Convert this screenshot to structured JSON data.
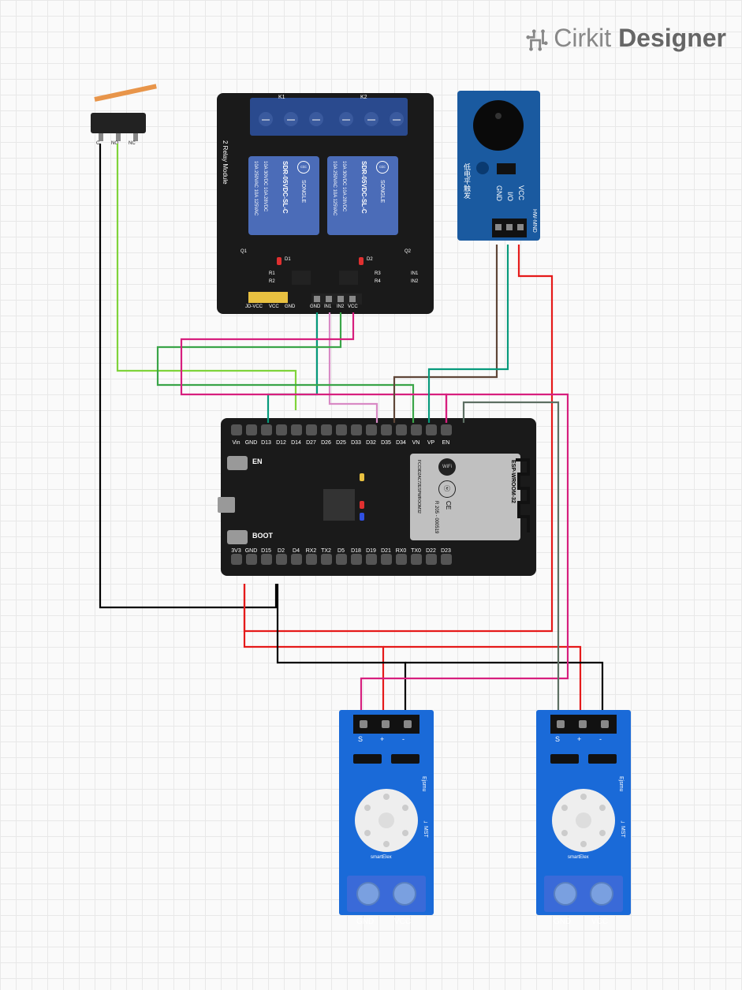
{
  "logo": {
    "brand1": "Cirkit",
    "brand2": "Designer"
  },
  "components": {
    "limit_switch": {
      "name": "Limit Switch",
      "pins": [
        "C",
        "NO",
        "NC"
      ]
    },
    "relay_module": {
      "name": "2 Relay Module",
      "side_label": "2 Relay Module",
      "top_conn_labels": [
        "K1",
        "K2"
      ],
      "relay_text": [
        "10A 250VAC 10A 125VAC",
        "10A 30VDC 10A 28VDC",
        "SDR-05VDC-SL-C",
        "SONGLE"
      ],
      "bottom_labels_left": [
        "JD-VCC",
        "VCC",
        "GND"
      ],
      "bottom_pins": [
        "GND",
        "IN1",
        "IN2",
        "VCC"
      ],
      "silks": [
        "Q1",
        "D1",
        "D2",
        "Q2",
        "R1",
        "R2",
        "R3",
        "R4",
        "IN1",
        "IN2"
      ]
    },
    "buzzer": {
      "name": "Active Buzzer Module",
      "pins": [
        "GND",
        "I/O",
        "VCC"
      ],
      "mfr": "HW-MND",
      "note_cn": "低电平触发"
    },
    "esp32": {
      "name": "ESP32 DevKit",
      "shield_text": [
        "ESP-WROOM-32",
        "WiFi",
        "FCC9D2AC72ESPWROOM32",
        "R 205 - 000519",
        "CE"
      ],
      "btn_en": "EN",
      "btn_boot": "BOOT",
      "top_pins": [
        "Vin",
        "GND",
        "D13",
        "D12",
        "D14",
        "D27",
        "D26",
        "D25",
        "D33",
        "D32",
        "D35",
        "D34",
        "VN",
        "VP",
        "EN"
      ],
      "bottom_pins": [
        "3V3",
        "GND",
        "D15",
        "D2",
        "D4",
        "RX2",
        "TX2",
        "D5",
        "D18",
        "D19",
        "D21",
        "RX0",
        "TX0",
        "D22",
        "D23"
      ]
    },
    "voltage_sensor": {
      "name": "Voltage Sensor",
      "header_pins": [
        "S",
        "+",
        "-"
      ],
      "term_labels": [
        "GND",
        "VCC"
      ],
      "silk": [
        "Ejsmu",
        "ᄂMST"
      ],
      "res_silk": [
        "smartElex"
      ]
    }
  },
  "wires": [
    {
      "id": "w1",
      "color": "#7fd33a",
      "from": "limit_switch.NO",
      "to": "esp32.D13",
      "desc": "lime-green"
    },
    {
      "id": "w2",
      "color": "#000000",
      "from": "limit_switch.C",
      "to": "esp32.GND_bottom",
      "desc": "black"
    },
    {
      "id": "w3",
      "color": "#079a7c",
      "from": "relay.GND",
      "to": "esp32.GND_top",
      "desc": "teal"
    },
    {
      "id": "w4",
      "color": "#d88ac5",
      "from": "relay.IN1",
      "to": "esp32.D25",
      "desc": "pink-light"
    },
    {
      "id": "w5",
      "color": "#3aa548",
      "from": "relay.IN2",
      "to": "esp32.D33",
      "desc": "green"
    },
    {
      "id": "w6",
      "color": "#d71f7e",
      "from": "relay.VCC",
      "to": "esp32.D35_rail",
      "desc": "magenta"
    },
    {
      "id": "w7",
      "color": "#5f4638",
      "from": "buzzer.GND",
      "to": "esp32.D33_area",
      "desc": "brown"
    },
    {
      "id": "w8",
      "color": "#079a7c",
      "from": "buzzer.IO",
      "to": "esp32.D32",
      "desc": "teal"
    },
    {
      "id": "w9",
      "color": "#e51a1a",
      "from": "buzzer.VCC",
      "to": "esp32.3V3",
      "desc": "red rail"
    },
    {
      "id": "w10",
      "color": "#000000",
      "from": "esp32.GND_bottom",
      "to": "vs1.-",
      "desc": "black"
    },
    {
      "id": "w11",
      "color": "#e51a1a",
      "from": "esp32.3V3",
      "to": "vs1.+",
      "desc": "red"
    },
    {
      "id": "w12",
      "color": "#d71f7e",
      "from": "esp32.D35",
      "to": "vs1.S",
      "desc": "magenta"
    },
    {
      "id": "w13",
      "color": "#000000",
      "from": "esp32.GND_bottom",
      "to": "vs2.-",
      "desc": "black"
    },
    {
      "id": "w14",
      "color": "#e51a1a",
      "from": "esp32.3V3",
      "to": "vs2.+",
      "desc": "red"
    },
    {
      "id": "w15",
      "color": "#5d6f63",
      "from": "esp32.D34",
      "to": "vs2.S",
      "desc": "olive-grey"
    }
  ]
}
